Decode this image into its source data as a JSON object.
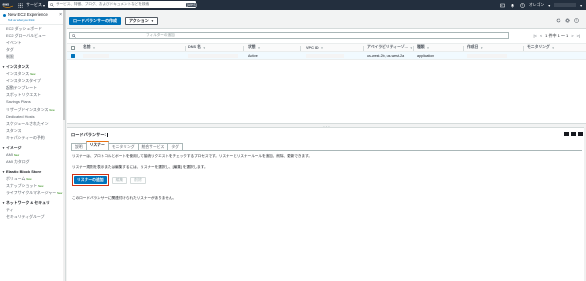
{
  "topbar": {
    "services_label": "サービス",
    "search_placeholder": "サービス、特徴、ブログ、およびドキュメントなどを検索",
    "shortcut": "[Alt+S]",
    "region": "オレゴン"
  },
  "sidebar": {
    "header_title": "New EC2 Experience",
    "header_sub": "Tell us what you think",
    "items": [
      {
        "type": "item",
        "label": "EC2 ダッシュボード"
      },
      {
        "type": "item",
        "label": "EC2 グローバルビュー"
      },
      {
        "type": "item",
        "label": "イベント"
      },
      {
        "type": "item",
        "label": "タグ"
      },
      {
        "type": "item",
        "label": "制限"
      },
      {
        "type": "gap"
      },
      {
        "type": "section",
        "label": "インスタンス"
      },
      {
        "type": "item",
        "label": "インスタンス",
        "badge": "New"
      },
      {
        "type": "item",
        "label": "インスタンスタイプ"
      },
      {
        "type": "item",
        "label": "起動テンプレート"
      },
      {
        "type": "item",
        "label": "スポットリクエスト"
      },
      {
        "type": "item",
        "label": "Savings Plans"
      },
      {
        "type": "item",
        "label": "リザーブドインスタンス",
        "badge": "New"
      },
      {
        "type": "item",
        "label": "Dedicated Hosts"
      },
      {
        "type": "item",
        "label": "スケジュールされたイン"
      },
      {
        "type": "item",
        "label": "スタンス"
      },
      {
        "type": "item",
        "label": "キャパシティーの予約"
      },
      {
        "type": "gap"
      },
      {
        "type": "section",
        "label": "イメージ"
      },
      {
        "type": "item",
        "label": "AMI",
        "badge": "New"
      },
      {
        "type": "item",
        "label": "AMI カタログ"
      },
      {
        "type": "gap"
      },
      {
        "type": "section",
        "label": "Elastic Block Store"
      },
      {
        "type": "item",
        "label": "ボリューム",
        "badge": "New"
      },
      {
        "type": "item",
        "label": "スナップショット",
        "badge": "New"
      },
      {
        "type": "item",
        "label": "ライフサイクルマネージャー",
        "badge": "New"
      },
      {
        "type": "gap"
      },
      {
        "type": "section",
        "label": "ネットワーク & セキュリ"
      },
      {
        "type": "item",
        "label": "ティ"
      },
      {
        "type": "item",
        "label": "セキュリティグループ"
      }
    ]
  },
  "toolbar": {
    "create_label": "ロードバランサーの作成",
    "actions_label": "アクション"
  },
  "table": {
    "filter_placeholder": "フィルターの追加",
    "pager": "1 件中 1 ～ 1",
    "columns": [
      "名前",
      "DNS 名",
      "状態",
      "VPC ID",
      "アベイラビリティーゾ...",
      "種類",
      "作成日",
      "モニタリング"
    ],
    "rows": [
      {
        "name": "",
        "dns": "",
        "state": "Active",
        "vpc": "",
        "az": "us-west-2b, us-west-2a",
        "type": "application",
        "created": "",
        "monitoring": ""
      }
    ]
  },
  "detail": {
    "title": "ロードバランサー:",
    "tabs": [
      "説明",
      "リスナー",
      "モニタリング",
      "統合サービス",
      "タグ"
    ],
    "active_tab": 1,
    "description": "リスナーは、プロトコルとポートを使用して接続リクエストをチェックするプロセスです。リスナーとリスナールールを追加、削除、更新できます。",
    "hint": "リスナー規則を表示または編集するには、リスナーを選択し、[編集] を選択します。",
    "add_listener": "リスナーの追加",
    "edit_label": "編集",
    "delete_label": "削除",
    "empty_message": "このロードバランサーに関連付けられたリスナーがありません。"
  },
  "colors": {
    "topbar": "#232f3e",
    "primary": "#0073bb",
    "highlight_border": "#d13212",
    "tab_accent": "#ec7211"
  }
}
